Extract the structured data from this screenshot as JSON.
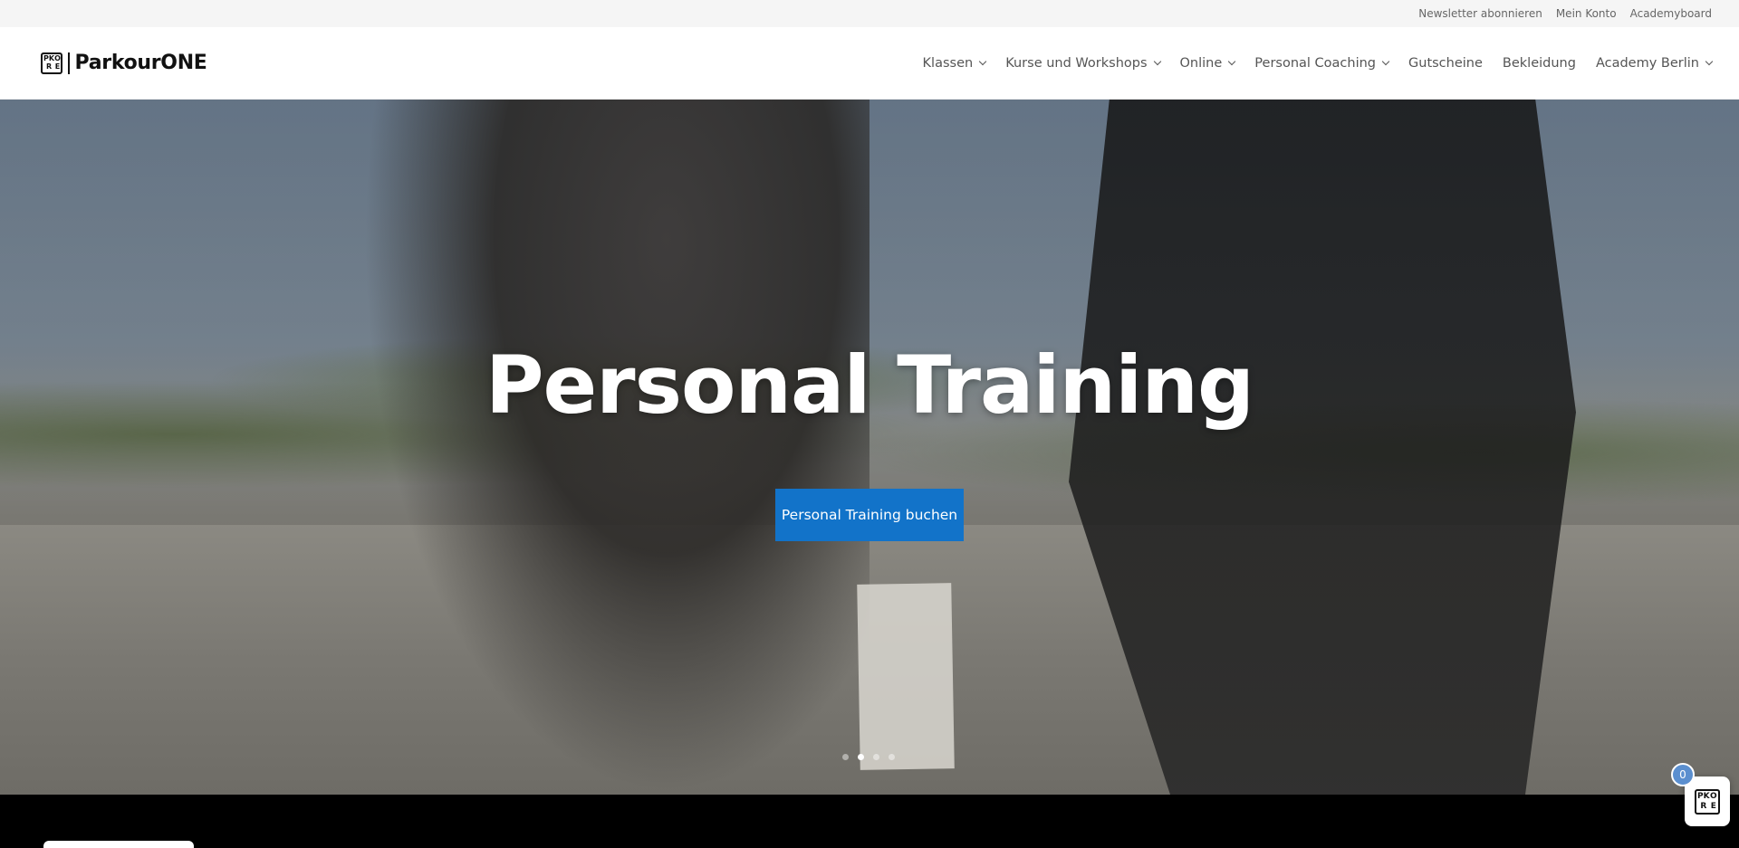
{
  "topbar": {
    "links": [
      "Newsletter abonnieren",
      "Mein Konto",
      "Academyboard"
    ]
  },
  "header": {
    "logo_text": "ParkourONE",
    "logo_mark": [
      "PK",
      "O",
      "R",
      "E"
    ],
    "nav": [
      {
        "label": "Klassen",
        "dropdown": true
      },
      {
        "label": "Kurse und Workshops",
        "dropdown": true
      },
      {
        "label": "Online",
        "dropdown": true
      },
      {
        "label": "Personal Coaching",
        "dropdown": true
      },
      {
        "label": "Gutscheine",
        "dropdown": false
      },
      {
        "label": "Bekleidung",
        "dropdown": false
      },
      {
        "label": "Academy Berlin",
        "dropdown": true
      }
    ]
  },
  "hero": {
    "title": "Personal Training",
    "cta_label": "Personal Training buchen",
    "slides_total": 4,
    "slide_active": 2
  },
  "cart": {
    "count": "0",
    "icon": "parkourone-logo-icon"
  },
  "colors": {
    "cta": "#1273c9",
    "badge": "#5b8fcf",
    "topbar_bg": "#f5f5f5"
  }
}
